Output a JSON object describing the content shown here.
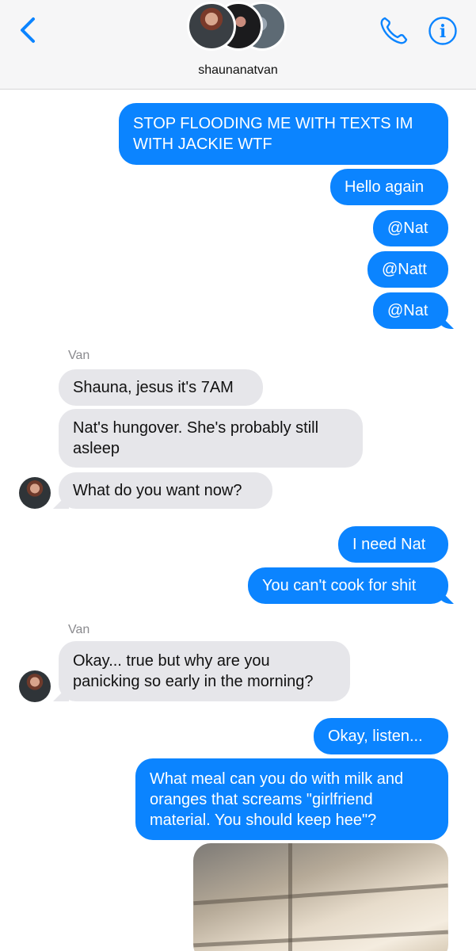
{
  "header": {
    "group_name": "shaunanatvan",
    "icons": {
      "back": "chevron-left-icon",
      "call": "phone-icon",
      "info": "info-icon"
    },
    "accent": "#0b84ff"
  },
  "messages": [
    {
      "from": "me",
      "text_lines": [
        "STOP FLOODING ME WITH TEXTS IM",
        "WITH JACKIE WTF"
      ]
    },
    {
      "from": "me",
      "text": "Hello again"
    },
    {
      "from": "me",
      "text": "@Nat"
    },
    {
      "from": "me",
      "text": "@Natt"
    },
    {
      "from": "me",
      "text": "@Nat"
    },
    {
      "from": "Van",
      "sender_label": "Van",
      "text": "Shauna, jesus it's 7AM"
    },
    {
      "from": "Van",
      "text_lines": [
        "Nat's hungover. She's probably still",
        "asleep"
      ]
    },
    {
      "from": "Van",
      "text": "What do you want now?"
    },
    {
      "from": "me",
      "text": "I need Nat"
    },
    {
      "from": "me",
      "text": "You can't cook for shit"
    },
    {
      "from": "Van",
      "sender_label": "Van",
      "text_lines": [
        "Okay... true but why are you",
        "panicking so early in the morning?"
      ]
    },
    {
      "from": "me",
      "text": "Okay, listen..."
    },
    {
      "from": "me",
      "text_lines": [
        "What meal can you do with milk and",
        "oranges that screams \"girlfriend",
        "material. You should keep hee\"?"
      ]
    },
    {
      "from": "me",
      "attachment": "photo"
    }
  ],
  "colors": {
    "outgoing_bubble": "#0b84ff",
    "incoming_bubble": "#e6e6ea",
    "sender_label": "#8a8a8e"
  }
}
